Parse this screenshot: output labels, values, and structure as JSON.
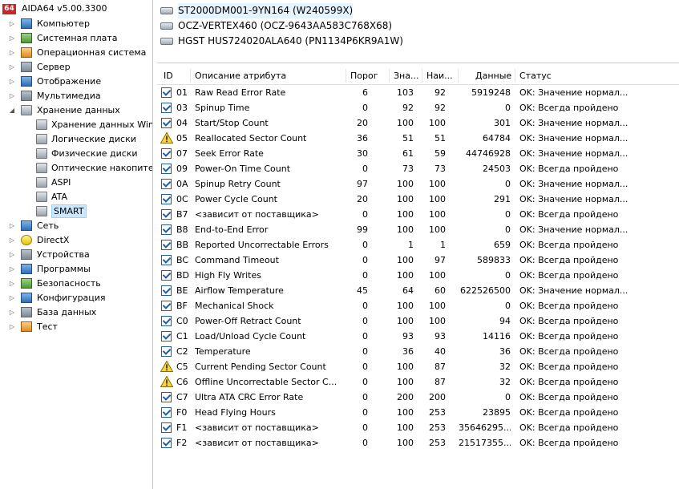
{
  "app": {
    "badge": "64",
    "title": "AIDA64 v5.00.3300"
  },
  "tree": [
    {
      "label": "Компьютер",
      "icon": "computer-icon",
      "expander": "▷"
    },
    {
      "label": "Системная плата",
      "icon": "motherboard-icon",
      "expander": "▷"
    },
    {
      "label": "Операционная система",
      "icon": "windows-icon",
      "expander": "▷"
    },
    {
      "label": "Сервер",
      "icon": "server-icon",
      "expander": "▷"
    },
    {
      "label": "Отображение",
      "icon": "monitor-icon",
      "expander": "▷"
    },
    {
      "label": "Мультимедиа",
      "icon": "multimedia-icon",
      "expander": "▷"
    },
    {
      "label": "Хранение данных",
      "icon": "storage-icon",
      "expander": "◢"
    },
    {
      "label": "Хранение данных Win",
      "icon": "drive-icon",
      "expander": ""
    },
    {
      "label": "Логические диски",
      "icon": "drive-icon",
      "expander": ""
    },
    {
      "label": "Физические диски",
      "icon": "drive-icon",
      "expander": ""
    },
    {
      "label": "Оптические накопите",
      "icon": "optical-drive-icon",
      "expander": ""
    },
    {
      "label": "ASPI",
      "icon": "aspi-icon",
      "expander": ""
    },
    {
      "label": "ATA",
      "icon": "drive-icon",
      "expander": ""
    },
    {
      "label": "SMART",
      "icon": "drive-icon",
      "expander": ""
    },
    {
      "label": "Сеть",
      "icon": "network-icon",
      "expander": "▷"
    },
    {
      "label": "DirectX",
      "icon": "directx-icon",
      "expander": "▷"
    },
    {
      "label": "Устройства",
      "icon": "devices-icon",
      "expander": "▷"
    },
    {
      "label": "Программы",
      "icon": "programs-icon",
      "expander": "▷"
    },
    {
      "label": "Безопасность",
      "icon": "security-shield-icon",
      "expander": "▷"
    },
    {
      "label": "Конфигурация",
      "icon": "configuration-icon",
      "expander": "▷"
    },
    {
      "label": "База данных",
      "icon": "database-icon",
      "expander": "▷"
    },
    {
      "label": "Тест",
      "icon": "benchmark-icon",
      "expander": "▷"
    }
  ],
  "devices": [
    {
      "label": "ST2000DM001-9YN164 (W240599X)",
      "selected": true
    },
    {
      "label": "OCZ-VERTEX460 (OCZ-9643AA583C768X68)",
      "selected": false
    },
    {
      "label": "HGST HUS724020ALA640 (PN1134P6KR9A1W)",
      "selected": false
    }
  ],
  "table": {
    "headers": {
      "id": "ID",
      "desc": "Описание атрибута",
      "threshold": "Порог",
      "value": "Зна...",
      "worst": "Наи...",
      "data": "Данные",
      "status": "Статус"
    },
    "rows": [
      {
        "flag": "ok",
        "id": "01",
        "desc": "Raw Read Error Rate",
        "threshold": "6",
        "value": "103",
        "worst": "92",
        "data": "5919248",
        "status": "OK: Значение нормал..."
      },
      {
        "flag": "ok",
        "id": "03",
        "desc": "Spinup Time",
        "threshold": "0",
        "value": "92",
        "worst": "92",
        "data": "0",
        "status": "OK: Всегда пройдено"
      },
      {
        "flag": "ok",
        "id": "04",
        "desc": "Start/Stop Count",
        "threshold": "20",
        "value": "100",
        "worst": "100",
        "data": "301",
        "status": "OK: Значение нормал..."
      },
      {
        "flag": "warn",
        "id": "05",
        "desc": "Reallocated Sector Count",
        "threshold": "36",
        "value": "51",
        "worst": "51",
        "data": "64784",
        "status": "OK: Значение нормал..."
      },
      {
        "flag": "ok",
        "id": "07",
        "desc": "Seek Error Rate",
        "threshold": "30",
        "value": "61",
        "worst": "59",
        "data": "44746928",
        "status": "OK: Значение нормал..."
      },
      {
        "flag": "ok",
        "id": "09",
        "desc": "Power-On Time Count",
        "threshold": "0",
        "value": "73",
        "worst": "73",
        "data": "24503",
        "status": "OK: Всегда пройдено"
      },
      {
        "flag": "ok",
        "id": "0A",
        "desc": "Spinup Retry Count",
        "threshold": "97",
        "value": "100",
        "worst": "100",
        "data": "0",
        "status": "OK: Значение нормал..."
      },
      {
        "flag": "ok",
        "id": "0C",
        "desc": "Power Cycle Count",
        "threshold": "20",
        "value": "100",
        "worst": "100",
        "data": "291",
        "status": "OK: Значение нормал..."
      },
      {
        "flag": "ok",
        "id": "B7",
        "desc": "<зависит от поставщика>",
        "threshold": "0",
        "value": "100",
        "worst": "100",
        "data": "0",
        "status": "OK: Всегда пройдено"
      },
      {
        "flag": "ok",
        "id": "B8",
        "desc": "End-to-End Error",
        "threshold": "99",
        "value": "100",
        "worst": "100",
        "data": "0",
        "status": "OK: Значение нормал..."
      },
      {
        "flag": "ok",
        "id": "BB",
        "desc": "Reported Uncorrectable Errors",
        "threshold": "0",
        "value": "1",
        "worst": "1",
        "data": "659",
        "status": "OK: Всегда пройдено"
      },
      {
        "flag": "ok",
        "id": "BC",
        "desc": "Command Timeout",
        "threshold": "0",
        "value": "100",
        "worst": "97",
        "data": "589833",
        "status": "OK: Всегда пройдено"
      },
      {
        "flag": "ok",
        "id": "BD",
        "desc": "High Fly Writes",
        "threshold": "0",
        "value": "100",
        "worst": "100",
        "data": "0",
        "status": "OK: Всегда пройдено"
      },
      {
        "flag": "ok",
        "id": "BE",
        "desc": "Airflow Temperature",
        "threshold": "45",
        "value": "64",
        "worst": "60",
        "data": "622526500",
        "status": "OK: Значение нормал..."
      },
      {
        "flag": "ok",
        "id": "BF",
        "desc": "Mechanical Shock",
        "threshold": "0",
        "value": "100",
        "worst": "100",
        "data": "0",
        "status": "OK: Всегда пройдено"
      },
      {
        "flag": "ok",
        "id": "C0",
        "desc": "Power-Off Retract Count",
        "threshold": "0",
        "value": "100",
        "worst": "100",
        "data": "94",
        "status": "OK: Всегда пройдено"
      },
      {
        "flag": "ok",
        "id": "C1",
        "desc": "Load/Unload Cycle Count",
        "threshold": "0",
        "value": "93",
        "worst": "93",
        "data": "14116",
        "status": "OK: Всегда пройдено"
      },
      {
        "flag": "ok",
        "id": "C2",
        "desc": "Temperature",
        "threshold": "0",
        "value": "36",
        "worst": "40",
        "data": "36",
        "status": "OK: Всегда пройдено"
      },
      {
        "flag": "warn",
        "id": "C5",
        "desc": "Current Pending Sector Count",
        "threshold": "0",
        "value": "100",
        "worst": "87",
        "data": "32",
        "status": "OK: Всегда пройдено"
      },
      {
        "flag": "warn",
        "id": "C6",
        "desc": "Offline Uncorrectable Sector C...",
        "threshold": "0",
        "value": "100",
        "worst": "87",
        "data": "32",
        "status": "OK: Всегда пройдено"
      },
      {
        "flag": "ok",
        "id": "C7",
        "desc": "Ultra ATA CRC Error Rate",
        "threshold": "0",
        "value": "200",
        "worst": "200",
        "data": "0",
        "status": "OK: Всегда пройдено"
      },
      {
        "flag": "ok",
        "id": "F0",
        "desc": "Head Flying Hours",
        "threshold": "0",
        "value": "100",
        "worst": "253",
        "data": "23895",
        "status": "OK: Всегда пройдено"
      },
      {
        "flag": "ok",
        "id": "F1",
        "desc": "<зависит от поставщика>",
        "threshold": "0",
        "value": "100",
        "worst": "253",
        "data": "35646295...",
        "status": "OK: Всегда пройдено"
      },
      {
        "flag": "ok",
        "id": "F2",
        "desc": "<зависит от поставщика>",
        "threshold": "0",
        "value": "100",
        "worst": "253",
        "data": "21517355...",
        "status": "OK: Всегда пройдено"
      }
    ]
  }
}
